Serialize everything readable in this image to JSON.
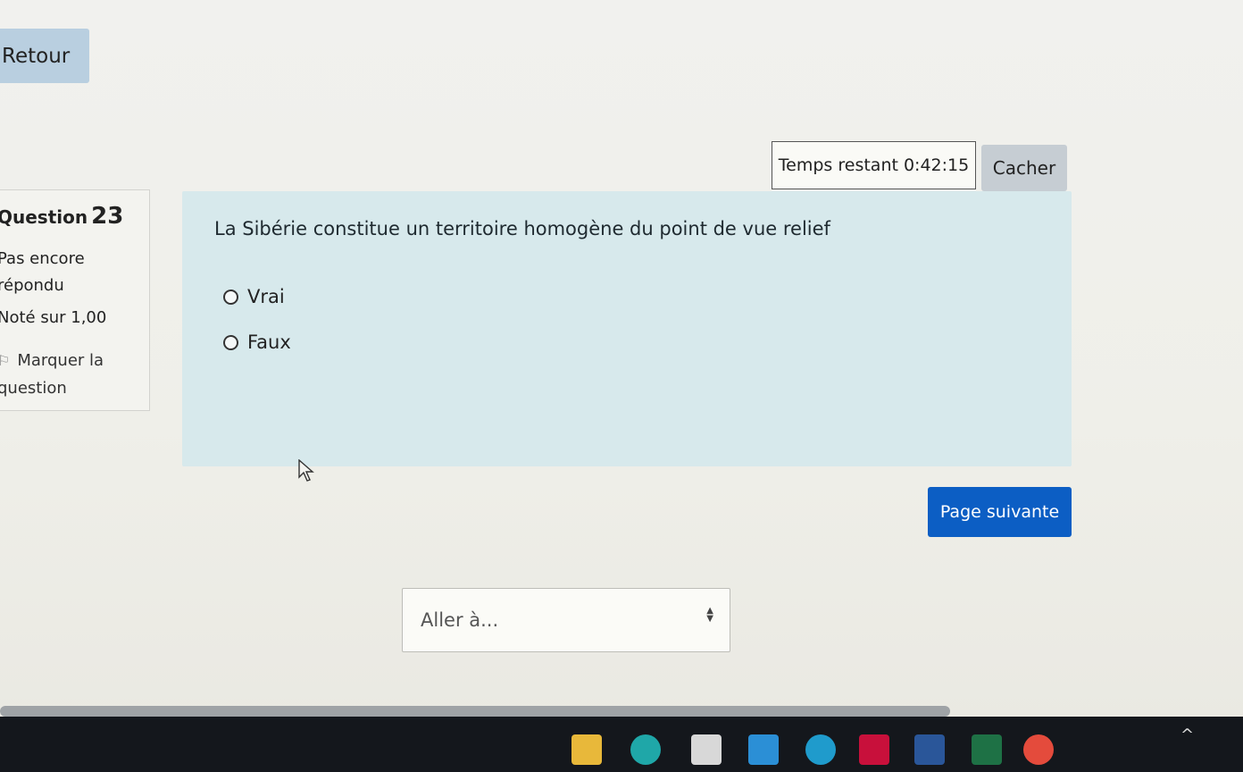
{
  "nav": {
    "back_label": "Retour"
  },
  "timer": {
    "label": "Temps restant",
    "value": "0:42:15",
    "hide_label": "Cacher"
  },
  "question_info": {
    "title": "Question",
    "number": "23",
    "state": "Pas encore répondu",
    "grade": "Noté sur 1,00",
    "flag_label": "Marquer la question"
  },
  "question": {
    "text": "La Sibérie constitue un territoire homogène du point de vue relief",
    "options": [
      "Vrai",
      "Faux"
    ]
  },
  "navigation": {
    "next_label": "Page suivante"
  },
  "jump": {
    "selected": "Aller à..."
  },
  "colors": {
    "primary": "#0c5ec4",
    "question_bg": "#d7e9ec",
    "back_button": "#b9cfe0"
  },
  "taskbar": {
    "icons": [
      "file-explorer-icon",
      "edge-icon",
      "store-icon",
      "myip-icon",
      "paint-icon",
      "mcafee-icon",
      "word-icon",
      "excel-icon",
      "chrome-icon"
    ]
  }
}
